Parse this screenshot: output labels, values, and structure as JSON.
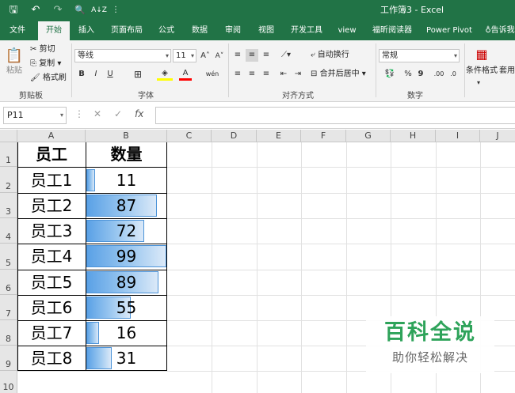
{
  "app": {
    "title": "工作簿3 - Excel",
    "quick_access": {
      "save": "🖫",
      "undo": "↶",
      "redo": "↷",
      "preview": "🔍",
      "sort": "A↓Z",
      "more": "⋮"
    }
  },
  "tabs": [
    "文件",
    "开始",
    "插入",
    "页面布局",
    "公式",
    "数据",
    "审阅",
    "视图",
    "开发工具",
    "view",
    "福昕阅读器",
    "Power Pivot",
    "告诉我"
  ],
  "active_tab": "开始",
  "ribbon": {
    "clipboard": {
      "paste": "粘贴",
      "cut": "剪切",
      "copy": "复制",
      "format_painter": "格式刷",
      "label": "剪贴板"
    },
    "font": {
      "name": "等线",
      "size": "11",
      "grow": "A˄",
      "shrink": "A˅",
      "bold": "B",
      "italic": "I",
      "underline": "U",
      "border": "⊞",
      "fill": "◈",
      "color": "A",
      "phonetic": "wén",
      "label": "字体"
    },
    "alignment": {
      "wrap": "自动换行",
      "merge": "合并后居中",
      "label": "对齐方式"
    },
    "number": {
      "format": "常规",
      "currency": "💱",
      "percent": "%",
      "comma": "9",
      "inc_dec": ".00",
      "dec_dec": ".0",
      "label": "数字"
    },
    "styles": {
      "conditional": "条件格式",
      "table_fmt": "套用表格格式"
    }
  },
  "formula_bar": {
    "name_box": "P11",
    "cancel": "✕",
    "enter": "✓",
    "fx": "fx",
    "value": ""
  },
  "columns": [
    "A",
    "B",
    "C",
    "D",
    "E",
    "F",
    "G",
    "H",
    "I",
    "J"
  ],
  "rows": [
    "1",
    "2",
    "3",
    "4",
    "5",
    "6",
    "7",
    "8",
    "9",
    "10"
  ],
  "table": {
    "header": {
      "col_a": "员工",
      "col_b": "数量"
    },
    "max_value": 99,
    "records": [
      {
        "name": "员工1",
        "qty": "11",
        "value": 11
      },
      {
        "name": "员工2",
        "qty": "87",
        "value": 87
      },
      {
        "name": "员工3",
        "qty": "72",
        "value": 72
      },
      {
        "name": "员工4",
        "qty": "99",
        "value": 99
      },
      {
        "name": "员工5",
        "qty": "89",
        "value": 89
      },
      {
        "name": "员工6",
        "qty": "55",
        "value": 55
      },
      {
        "name": "员工7",
        "qty": "16",
        "value": 16
      },
      {
        "name": "员工8",
        "qty": "31",
        "value": 31
      }
    ]
  },
  "watermark": {
    "title": "百科全说",
    "subtitle": "助你轻松解决"
  },
  "colors": {
    "brand": "#217346",
    "bar_start": "#5aa1e6",
    "bar_end": "#dbe9f8",
    "watermark": "#2ea35a"
  }
}
